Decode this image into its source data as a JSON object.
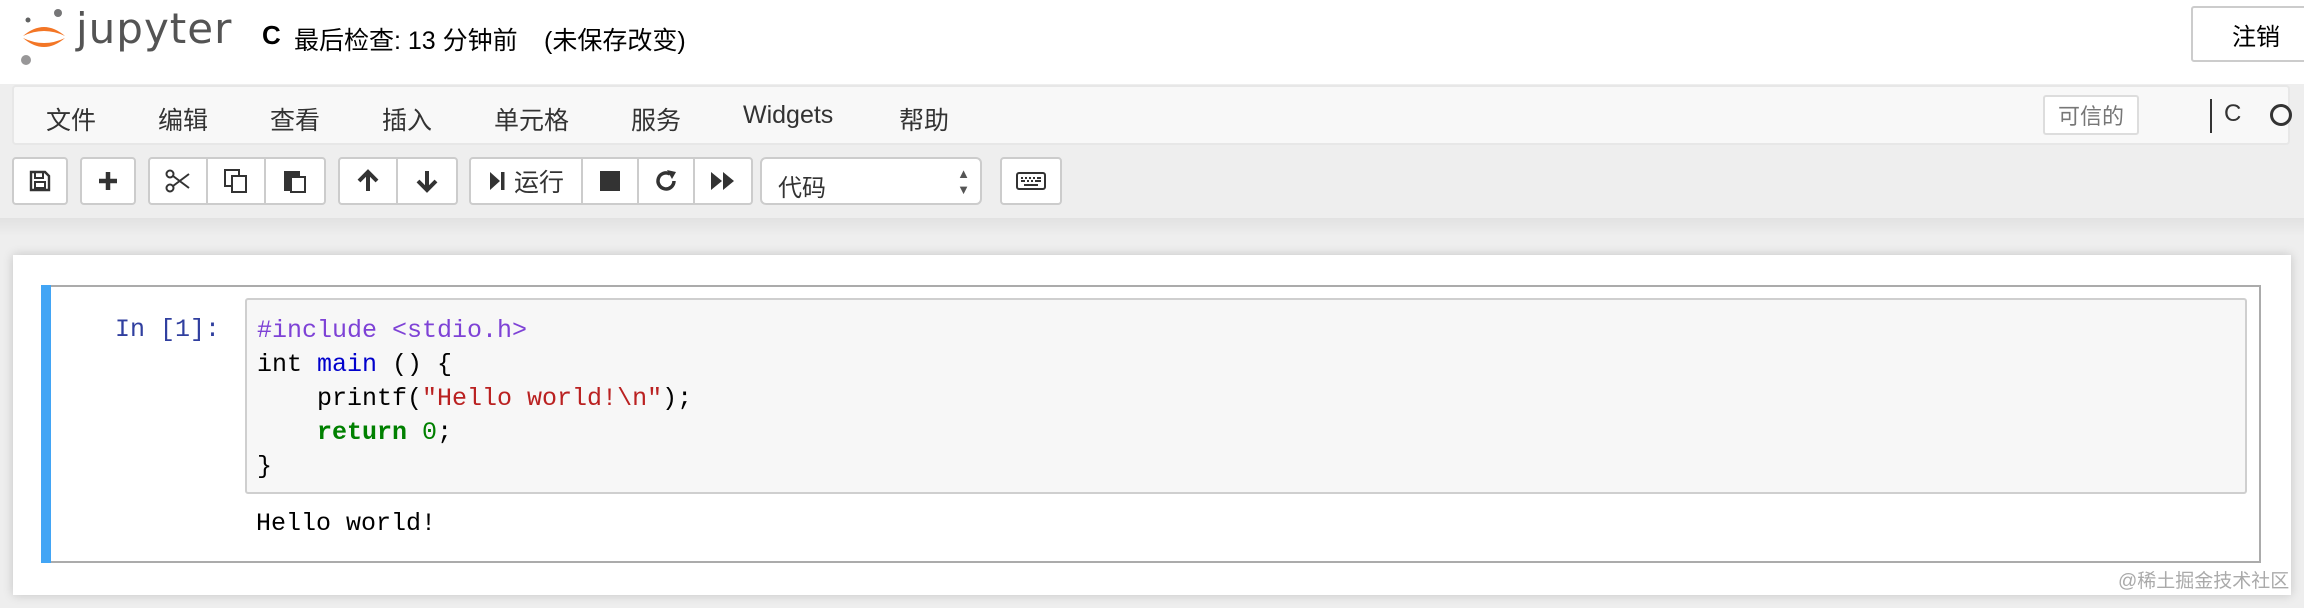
{
  "header": {
    "logo_text": "jupyter",
    "notebook_name": "C",
    "checkpoint": "最后检查: 13 分钟前",
    "autosave_status": "(未保存改变)",
    "logout_label": "注销"
  },
  "menubar": {
    "items": [
      "文件",
      "编辑",
      "查看",
      "插入",
      "单元格",
      "服务",
      "Widgets",
      "帮助"
    ],
    "trusted_label": "可信的",
    "kernel_name": "C"
  },
  "toolbar": {
    "run_label": "运行",
    "cell_type": "代码",
    "icons": [
      "save-icon",
      "plus-icon",
      "cut-icon",
      "copy-icon",
      "paste-icon",
      "arrow-up-icon",
      "arrow-down-icon",
      "run-icon",
      "stop-icon",
      "restart-icon",
      "fast-forward-icon",
      "keyboard-icon"
    ]
  },
  "cell": {
    "prompt": "In [1]:",
    "code": {
      "line1": "#include <stdio.h>",
      "line2_type": "int",
      "line2_fn": "main",
      "line2_rest": " () {",
      "line3_fn": "    printf(",
      "line3_str": "\"Hello world!\\n\"",
      "line3_end": ");",
      "line4_kw": "return",
      "line4_num": "0",
      "line4_end": ";",
      "line5": "}"
    },
    "output": "Hello world!"
  },
  "watermark": "@稀土掘金技术社区",
  "colors": {
    "accent_bar": "#42a5f5",
    "logo_orange": "#f37626",
    "prompt": "#303f9f"
  }
}
